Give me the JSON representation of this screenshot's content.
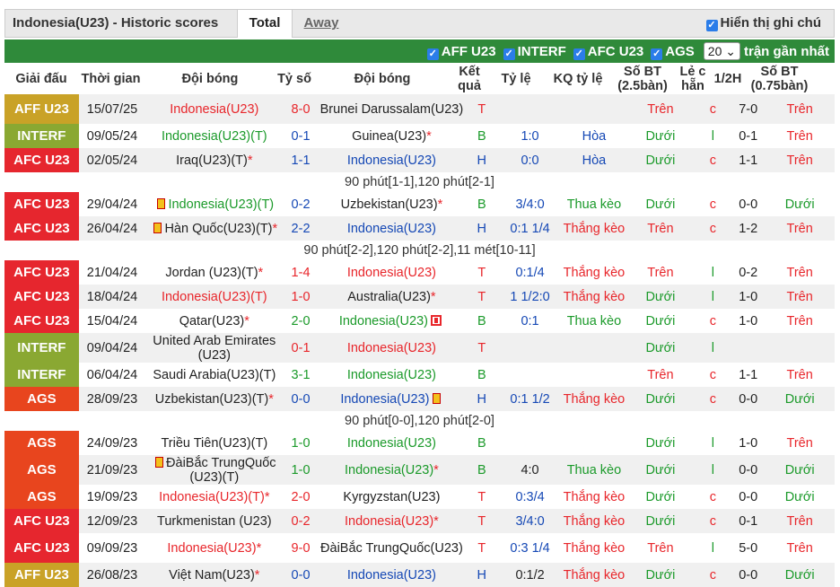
{
  "header": {
    "title": "Indonesia(U23) - Historic scores",
    "tab_total": "Total",
    "tab_away": "Away",
    "show_label": "Hiển thị ghi chú"
  },
  "filters": {
    "items": [
      "AFF U23",
      "INTERF",
      "AFC U23",
      "AGS"
    ],
    "count": "20",
    "suffix": "trận gần nhất"
  },
  "columns": [
    "Giải đấu",
    "Thời gian",
    "Đội bóng",
    "Tỷ số",
    "Đội bóng",
    "Kết quả",
    "Tỷ lệ",
    "KQ tỷ lệ",
    "Số BT (2.5bàn)",
    "Lẻ c hẵn",
    "1/2H",
    "Số BT (0.75bàn)"
  ],
  "colors": {
    "AFF U23": "#c9a227",
    "INTERF": "#8aa832",
    "AFC U23": "#e6262e",
    "AGS": "#e8451e"
  },
  "rows": [
    {
      "type": "m",
      "league": "AFF U23",
      "date": "15/07/25",
      "home": "Indonesia(U23)",
      "hc": "red",
      "score": "8-0",
      "sc": "red",
      "away": "Brunei Darussalam(U23)",
      "ac": "dark",
      "awrap": true,
      "res": "T",
      "rc": "red",
      "odds": "",
      "oc": "blue",
      "kq": "",
      "kc": "green",
      "bt": "Trên",
      "btc": "red",
      "lc": "c",
      "lcc": "red",
      "h": "7-0",
      "bt2": "Trên",
      "bt2c": "red"
    },
    {
      "type": "m",
      "league": "INTERF",
      "date": "09/05/24",
      "home": "Indonesia(U23)(T)",
      "hc": "green",
      "score": "0-1",
      "sc": "blue",
      "away": "Guinea(U23)",
      "ac": "dark",
      "astar": true,
      "res": "B",
      "rc": "green",
      "odds": "1:0",
      "oc": "blue",
      "kq": "Hòa",
      "kc": "blue",
      "bt": "Dưới",
      "btc": "green",
      "lc": "l",
      "lcc": "green",
      "h": "0-1",
      "bt2": "Trên",
      "bt2c": "red"
    },
    {
      "type": "m",
      "league": "AFC U23",
      "date": "02/05/24",
      "home": "Iraq(U23)(T)",
      "hstar": true,
      "hc": "dark",
      "score": "1-1",
      "sc": "blue",
      "away": "Indonesia(U23)",
      "ac": "blue",
      "res": "H",
      "rc": "blue",
      "odds": "0:0",
      "oc": "blue",
      "kq": "Hòa",
      "kc": "blue",
      "bt": "Dưới",
      "btc": "green",
      "lc": "c",
      "lcc": "red",
      "h": "1-1",
      "bt2": "Trên",
      "bt2c": "red"
    },
    {
      "type": "n",
      "text": "90 phút[1-1],120 phút[2-1]"
    },
    {
      "type": "m",
      "league": "AFC U23",
      "date": "29/04/24",
      "home": "Indonesia(U23)(T)",
      "hcard": "yc",
      "hc": "green",
      "score": "0-2",
      "sc": "blue",
      "away": "Uzbekistan(U23)",
      "ac": "dark",
      "astar": true,
      "res": "B",
      "rc": "green",
      "odds": "3/4:0",
      "oc": "blue",
      "kq": "Thua kèo",
      "kc": "green",
      "bt": "Dưới",
      "btc": "green",
      "lc": "c",
      "lcc": "red",
      "h": "0-0",
      "bt2": "Dưới",
      "bt2c": "green"
    },
    {
      "type": "m",
      "league": "AFC U23",
      "date": "26/04/24",
      "home": "Hàn Quốc(U23)(T)",
      "hcard": "yc",
      "hstar": true,
      "hc": "dark",
      "score": "2-2",
      "sc": "blue",
      "away": "Indonesia(U23)",
      "ac": "blue",
      "res": "H",
      "rc": "blue",
      "odds": "0:1 1/4",
      "oc": "blue",
      "kq": "Thắng kèo",
      "kc": "red",
      "bt": "Trên",
      "btc": "red",
      "lc": "c",
      "lcc": "red",
      "h": "1-2",
      "bt2": "Trên",
      "bt2c": "red"
    },
    {
      "type": "n",
      "text": "90 phút[2-2],120 phút[2-2],11 mét[10-11]"
    },
    {
      "type": "m",
      "league": "AFC U23",
      "date": "21/04/24",
      "home": "Jordan (U23)(T)",
      "hstar": true,
      "hc": "dark",
      "score": "1-4",
      "sc": "red",
      "away": "Indonesia(U23)",
      "ac": "red",
      "res": "T",
      "rc": "red",
      "odds": "0:1/4",
      "oc": "blue",
      "kq": "Thắng kèo",
      "kc": "red",
      "bt": "Trên",
      "btc": "red",
      "lc": "l",
      "lcc": "green",
      "h": "0-2",
      "bt2": "Trên",
      "bt2c": "red"
    },
    {
      "type": "m",
      "league": "AFC U23",
      "date": "18/04/24",
      "home": "Indonesia(U23)(T)",
      "hc": "red",
      "score": "1-0",
      "sc": "red",
      "away": "Australia(U23)",
      "ac": "dark",
      "astar": true,
      "res": "T",
      "rc": "red",
      "odds": "1 1/2:0",
      "oc": "blue",
      "kq": "Thắng kèo",
      "kc": "red",
      "bt": "Dưới",
      "btc": "green",
      "lc": "l",
      "lcc": "green",
      "h": "1-0",
      "bt2": "Trên",
      "bt2c": "red"
    },
    {
      "type": "m",
      "league": "AFC U23",
      "date": "15/04/24",
      "home": "Qatar(U23)",
      "hstar": true,
      "hc": "dark",
      "score": "2-0",
      "sc": "green",
      "away": "Indonesia(U23)",
      "ac": "green",
      "acard": "rcb",
      "res": "B",
      "rc": "green",
      "odds": "0:1",
      "oc": "blue",
      "kq": "Thua kèo",
      "kc": "green",
      "bt": "Dưới",
      "btc": "green",
      "lc": "c",
      "lcc": "red",
      "h": "1-0",
      "bt2": "Trên",
      "bt2c": "red"
    },
    {
      "type": "m",
      "league": "INTERF",
      "date": "09/04/24",
      "home": "United Arab Emirates (U23)",
      "hwrap": true,
      "hc": "dark",
      "score": "0-1",
      "sc": "red",
      "away": "Indonesia(U23)",
      "ac": "red",
      "res": "T",
      "rc": "red",
      "odds": "",
      "oc": "blue",
      "kq": "",
      "kc": "green",
      "bt": "Dưới",
      "btc": "green",
      "lc": "l",
      "lcc": "green",
      "h": "",
      "bt2": "",
      "bt2c": "red"
    },
    {
      "type": "m",
      "league": "INTERF",
      "date": "06/04/24",
      "home": "Saudi Arabia(U23)(T)",
      "hc": "dark",
      "score": "3-1",
      "sc": "green",
      "away": "Indonesia(U23)",
      "ac": "green",
      "res": "B",
      "rc": "green",
      "odds": "",
      "oc": "blue",
      "kq": "",
      "kc": "green",
      "bt": "Trên",
      "btc": "red",
      "lc": "c",
      "lcc": "red",
      "h": "1-1",
      "bt2": "Trên",
      "bt2c": "red"
    },
    {
      "type": "m",
      "league": "AGS",
      "date": "28/09/23",
      "home": "Uzbekistan(U23)(T)",
      "hstar": true,
      "hc": "dark",
      "score": "0-0",
      "sc": "blue",
      "away": "Indonesia(U23)",
      "ac": "blue",
      "acard": "yc",
      "res": "H",
      "rc": "blue",
      "odds": "0:1 1/2",
      "oc": "blue",
      "kq": "Thắng kèo",
      "kc": "red",
      "bt": "Dưới",
      "btc": "green",
      "lc": "c",
      "lcc": "red",
      "h": "0-0",
      "bt2": "Dưới",
      "bt2c": "green"
    },
    {
      "type": "n",
      "text": "90 phút[0-0],120 phút[2-0]"
    },
    {
      "type": "m",
      "league": "AGS",
      "date": "24/09/23",
      "home": "Triều Tiên(U23)(T)",
      "hc": "dark",
      "score": "1-0",
      "sc": "green",
      "away": "Indonesia(U23)",
      "ac": "green",
      "res": "B",
      "rc": "green",
      "odds": "",
      "oc": "blue",
      "kq": "",
      "kc": "green",
      "bt": "Dưới",
      "btc": "green",
      "lc": "l",
      "lcc": "green",
      "h": "1-0",
      "bt2": "Trên",
      "bt2c": "red"
    },
    {
      "type": "m",
      "league": "AGS",
      "date": "21/09/23",
      "home": "ĐàiBắc TrungQuốc (U23)(T)",
      "hcard": "yc",
      "hwrap": true,
      "hc": "dark",
      "score": "1-0",
      "sc": "green",
      "away": "Indonesia(U23)",
      "astar": true,
      "ac": "green",
      "res": "B",
      "rc": "green",
      "odds": "4:0",
      "oc": "dark",
      "kq": "Thua kèo",
      "kc": "green",
      "bt": "Dưới",
      "btc": "green",
      "lc": "l",
      "lcc": "green",
      "h": "0-0",
      "bt2": "Dưới",
      "bt2c": "green"
    },
    {
      "type": "m",
      "league": "AGS",
      "date": "19/09/23",
      "home": "Indonesia(U23)(T)",
      "hstar": true,
      "hc": "red",
      "score": "2-0",
      "sc": "red",
      "away": "Kyrgyzstan(U23)",
      "ac": "dark",
      "res": "T",
      "rc": "red",
      "odds": "0:3/4",
      "oc": "blue",
      "kq": "Thắng kèo",
      "kc": "red",
      "bt": "Dưới",
      "btc": "green",
      "lc": "c",
      "lcc": "red",
      "h": "0-0",
      "bt2": "Dưới",
      "bt2c": "green"
    },
    {
      "type": "m",
      "league": "AFC U23",
      "date": "12/09/23",
      "home": "Turkmenistan (U23)",
      "hc": "dark",
      "score": "0-2",
      "sc": "red",
      "away": "Indonesia(U23)",
      "astar": true,
      "ac": "red",
      "res": "T",
      "rc": "red",
      "odds": "3/4:0",
      "oc": "blue",
      "kq": "Thắng kèo",
      "kc": "red",
      "bt": "Dưới",
      "btc": "green",
      "lc": "c",
      "lcc": "red",
      "h": "0-1",
      "bt2": "Trên",
      "bt2c": "red"
    },
    {
      "type": "m",
      "league": "AFC U23",
      "date": "09/09/23",
      "home": "Indonesia(U23)",
      "hstar": true,
      "hc": "red",
      "score": "9-0",
      "sc": "red",
      "away": "ĐàiBắc TrungQuốc(U23)",
      "awrap": true,
      "ac": "dark",
      "res": "T",
      "rc": "red",
      "odds": "0:3 1/4",
      "oc": "blue",
      "kq": "Thắng kèo",
      "kc": "red",
      "bt": "Trên",
      "btc": "red",
      "lc": "l",
      "lcc": "green",
      "h": "5-0",
      "bt2": "Trên",
      "bt2c": "red"
    },
    {
      "type": "m",
      "league": "AFF U23",
      "date": "26/08/23",
      "home": "Việt Nam(U23)",
      "hstar": true,
      "hc": "dark",
      "score": "0-0",
      "sc": "blue",
      "away": "Indonesia(U23)",
      "ac": "blue",
      "res": "H",
      "rc": "blue",
      "odds": "0:1/2",
      "oc": "dark",
      "kq": "Thắng kèo",
      "kc": "red",
      "bt": "Dưới",
      "btc": "green",
      "lc": "c",
      "lcc": "red",
      "h": "0-0",
      "bt2": "Dưới",
      "bt2c": "green"
    }
  ]
}
